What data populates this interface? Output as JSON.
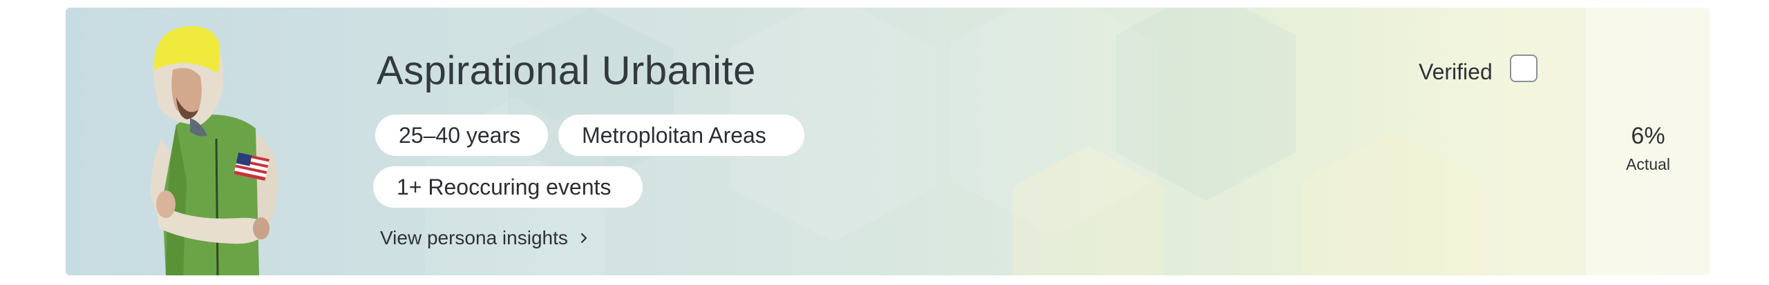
{
  "persona": {
    "name": "Aspirational Urbanite",
    "tags": {
      "age": "25–40 years",
      "area": "Metroploitan Areas",
      "events": "1+ Reoccuring events"
    },
    "insights_link": "View persona insights",
    "verified_label": "Verified",
    "verified_checked": false,
    "actual_value": "6%",
    "actual_label": "Actual"
  },
  "colors": {
    "card_gradient_start": "#c7dce2",
    "card_gradient_end": "#f5f6e6",
    "chip_background": "#ffffff",
    "text": "#333a3f",
    "hoodie_yellow": "#f0ea3c",
    "vest_green": "#6aa447"
  },
  "icons": {
    "insights_chevron": "chevron-right-icon",
    "persona_image": "hoodie-man-portrait"
  }
}
